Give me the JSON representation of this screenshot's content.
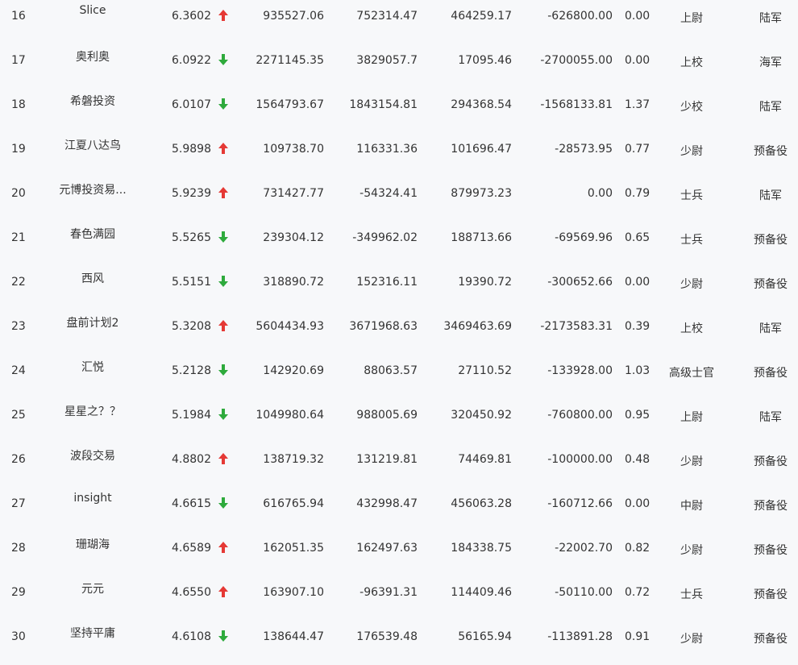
{
  "colors": {
    "up": "#e53935",
    "down": "#2eaa3c"
  },
  "rows": [
    {
      "rank": "16",
      "name": "Slice",
      "score": "6.3602",
      "trend": "up",
      "v1": "935527.06",
      "v2": "752314.47",
      "v3": "464259.17",
      "v4": "-626800.00",
      "ratio": "0.00",
      "mil_rank": "上尉",
      "branch": "陆军"
    },
    {
      "rank": "17",
      "name": "奥利奥",
      "score": "6.0922",
      "trend": "down",
      "v1": "2271145.35",
      "v2": "3829057.7",
      "v3": "17095.46",
      "v4": "-2700055.00",
      "ratio": "0.00",
      "mil_rank": "上校",
      "branch": "海军"
    },
    {
      "rank": "18",
      "name": "希磐投资",
      "score": "6.0107",
      "trend": "down",
      "v1": "1564793.67",
      "v2": "1843154.81",
      "v3": "294368.54",
      "v4": "-1568133.81",
      "ratio": "1.37",
      "mil_rank": "少校",
      "branch": "陆军"
    },
    {
      "rank": "19",
      "name": "江夏八达鸟",
      "score": "5.9898",
      "trend": "up",
      "v1": "109738.70",
      "v2": "116331.36",
      "v3": "101696.47",
      "v4": "-28573.95",
      "ratio": "0.77",
      "mil_rank": "少尉",
      "branch": "预备役"
    },
    {
      "rank": "20",
      "name": "元博投资易...",
      "score": "5.9239",
      "trend": "up",
      "v1": "731427.77",
      "v2": "-54324.41",
      "v3": "879973.23",
      "v4": "0.00",
      "ratio": "0.79",
      "mil_rank": "士兵",
      "branch": "陆军"
    },
    {
      "rank": "21",
      "name": "春色满园",
      "score": "5.5265",
      "trend": "down",
      "v1": "239304.12",
      "v2": "-349962.02",
      "v3": "188713.66",
      "v4": "-69569.96",
      "ratio": "0.65",
      "mil_rank": "士兵",
      "branch": "预备役"
    },
    {
      "rank": "22",
      "name": "西风",
      "score": "5.5151",
      "trend": "down",
      "v1": "318890.72",
      "v2": "152316.11",
      "v3": "19390.72",
      "v4": "-300652.66",
      "ratio": "0.00",
      "mil_rank": "少尉",
      "branch": "预备役"
    },
    {
      "rank": "23",
      "name": "盘前计划2",
      "score": "5.3208",
      "trend": "up",
      "v1": "5604434.93",
      "v2": "3671968.63",
      "v3": "3469463.69",
      "v4": "-2173583.31",
      "ratio": "0.39",
      "mil_rank": "上校",
      "branch": "陆军"
    },
    {
      "rank": "24",
      "name": "汇悦",
      "score": "5.2128",
      "trend": "down",
      "v1": "142920.69",
      "v2": "88063.57",
      "v3": "27110.52",
      "v4": "-133928.00",
      "ratio": "1.03",
      "mil_rank": "高级士官",
      "branch": "预备役"
    },
    {
      "rank": "25",
      "name": "星星之？？",
      "score": "5.1984",
      "trend": "down",
      "v1": "1049980.64",
      "v2": "988005.69",
      "v3": "320450.92",
      "v4": "-760800.00",
      "ratio": "0.95",
      "mil_rank": "上尉",
      "branch": "陆军"
    },
    {
      "rank": "26",
      "name": "波段交易",
      "score": "4.8802",
      "trend": "up",
      "v1": "138719.32",
      "v2": "131219.81",
      "v3": "74469.81",
      "v4": "-100000.00",
      "ratio": "0.48",
      "mil_rank": "少尉",
      "branch": "预备役"
    },
    {
      "rank": "27",
      "name": "insight",
      "score": "4.6615",
      "trend": "down",
      "v1": "616765.94",
      "v2": "432998.47",
      "v3": "456063.28",
      "v4": "-160712.66",
      "ratio": "0.00",
      "mil_rank": "中尉",
      "branch": "预备役"
    },
    {
      "rank": "28",
      "name": "珊瑚海",
      "score": "4.6589",
      "trend": "up",
      "v1": "162051.35",
      "v2": "162497.63",
      "v3": "184338.75",
      "v4": "-22002.70",
      "ratio": "0.82",
      "mil_rank": "少尉",
      "branch": "预备役"
    },
    {
      "rank": "29",
      "name": "元元",
      "score": "4.6550",
      "trend": "up",
      "v1": "163907.10",
      "v2": "-96391.31",
      "v3": "114409.46",
      "v4": "-50110.00",
      "ratio": "0.72",
      "mil_rank": "士兵",
      "branch": "预备役"
    },
    {
      "rank": "30",
      "name": "坚持平庸",
      "score": "4.6108",
      "trend": "down",
      "v1": "138644.47",
      "v2": "176539.48",
      "v3": "56165.94",
      "v4": "-113891.28",
      "ratio": "0.91",
      "mil_rank": "少尉",
      "branch": "预备役"
    }
  ]
}
